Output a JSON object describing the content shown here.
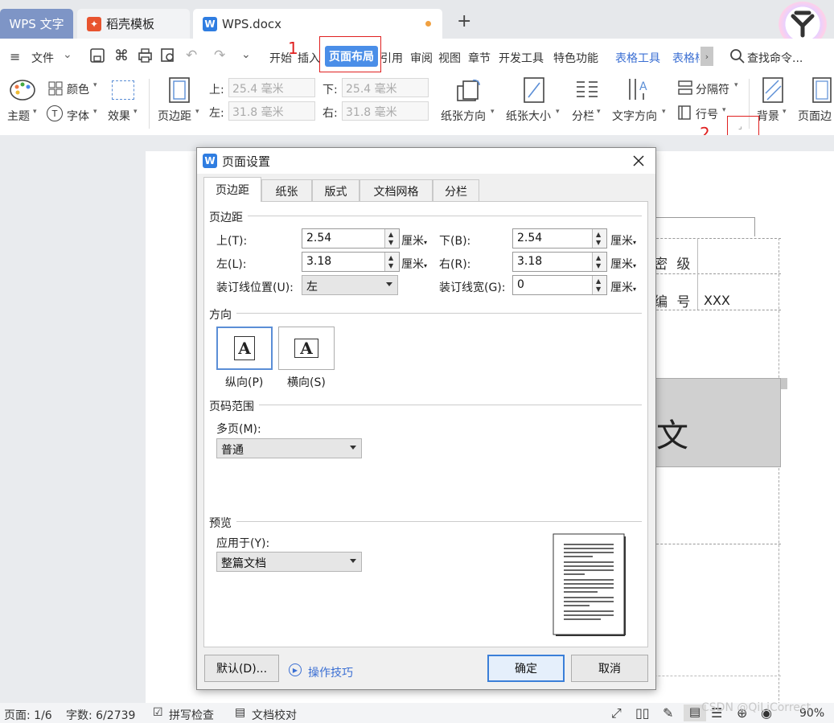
{
  "tabs": {
    "wps": "WPS 文字",
    "daoke": "稻壳模板",
    "doc": "WPS.docx",
    "plus": "+"
  },
  "menu": {
    "file": "文件",
    "items": [
      "开始",
      "插入",
      "页面布局",
      "引用",
      "审阅",
      "视图",
      "章节",
      "开发工具",
      "特色功能"
    ],
    "table_tools": "表格工具",
    "table_style": "表格样",
    "search": "查找命令..."
  },
  "ribbon": {
    "theme": "主题",
    "color": "颜色",
    "font": "字体",
    "effect": "效果",
    "margin": "页边距",
    "top_label": "上:",
    "top_value": "25.4 毫米",
    "bottom_label": "下:",
    "bottom_value": "25.4 毫米",
    "left_label": "左:",
    "left_value": "31.8 毫米",
    "right_label": "右:",
    "right_value": "31.8 毫米",
    "orientation": "纸张方向",
    "size": "纸张大小",
    "columns": "分栏",
    "text_dir": "文字方向",
    "separator": "分隔符",
    "line_no": "行号",
    "background": "背景",
    "page_border": "页面边"
  },
  "annotations": {
    "step1": "1",
    "step2": "2、"
  },
  "document": {
    "cell_jiji": "密 级",
    "cell_bianhao": "编 号",
    "cell_xxx": "XXX",
    "big_char": "文"
  },
  "dialog": {
    "title": "页面设置",
    "tabs": [
      "页边距",
      "纸张",
      "版式",
      "文档网格",
      "分栏"
    ],
    "group_margin": "页边距",
    "top_label": "上(T):",
    "top_value": "2.54",
    "bottom_label": "下(B):",
    "bottom_value": "2.54",
    "left_label": "左(L):",
    "left_value": "3.18",
    "right_label": "右(R):",
    "right_value": "3.18",
    "gutter_pos_label": "装订线位置(U):",
    "gutter_pos_value": "左",
    "gutter_width_label": "装订线宽(G):",
    "gutter_width_value": "0",
    "unit": "厘米",
    "group_orientation": "方向",
    "portrait": "纵向(P)",
    "landscape": "横向(S)",
    "group_pages": "页码范围",
    "multi_pages_label": "多页(M):",
    "multi_pages_value": "普通",
    "group_preview": "预览",
    "apply_label": "应用于(Y):",
    "apply_value": "整篇文档",
    "default_btn": "默认(D)...",
    "tips": "操作技巧",
    "ok_btn": "确定",
    "cancel_btn": "取消"
  },
  "status": {
    "page": "页面: 1/6",
    "words": "字数: 6/2739",
    "spell": "拼写检查",
    "proof": "文档校对",
    "zoom": "90%",
    "watermark": "CSDN @QiLiCorrect"
  },
  "colors": {
    "accent": "#3b6fd3",
    "highlight_tab": "#4a8ee8",
    "red_annotation": "#e02020",
    "tab_wps": "#7e95c6"
  }
}
